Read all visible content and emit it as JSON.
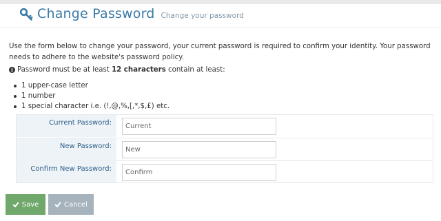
{
  "header": {
    "title": "Change Password",
    "subtitle": "Change your password",
    "icon": "key-icon"
  },
  "intro": "Use the form below to change your password, your current password is required to confirm your identity. Your password needs to adhere to the website's password policy.",
  "requirement": {
    "prefix": "Password must be at least ",
    "emphasis": "12 characters",
    "suffix": " contain at least:"
  },
  "rules": [
    "1 upper-case letter",
    "1 number",
    "1 special character i.e. (!,@,%,[,*,$,£) etc."
  ],
  "form": {
    "current": {
      "label": "Current Password:",
      "placeholder": "Current"
    },
    "new": {
      "label": "New Password:",
      "placeholder": "New"
    },
    "confirm": {
      "label": "Confirm New Password:",
      "placeholder": "Confirm"
    }
  },
  "buttons": {
    "save": "Save",
    "cancel": "Cancel"
  },
  "colors": {
    "title": "#3b7aa8",
    "save": "#6fa86a",
    "cancel": "#a6b3bd",
    "label_bg": "#eef3f7"
  }
}
